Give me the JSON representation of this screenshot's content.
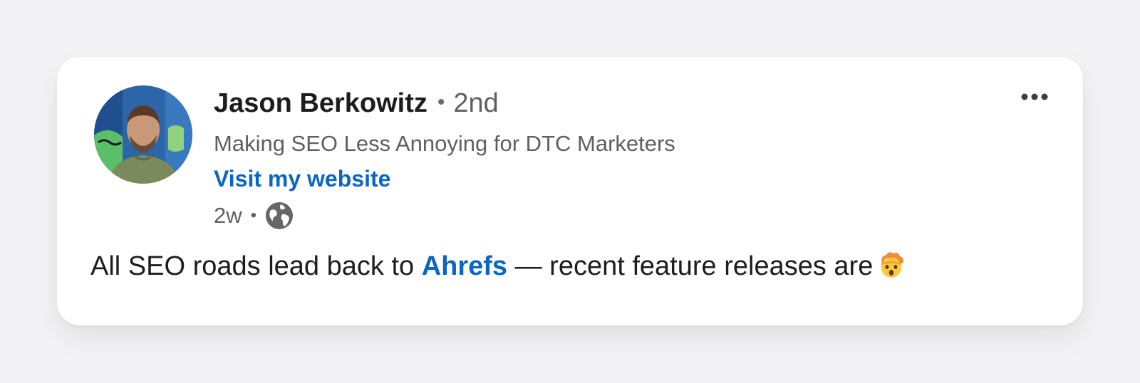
{
  "post": {
    "author": {
      "name": "Jason Berkowitz",
      "separator": "•",
      "connection_degree": "2nd",
      "headline": "Making SEO Less Annoying for DTC Marketers",
      "website_link": "Visit my website"
    },
    "timestamp": "2w",
    "timestamp_separator": "•",
    "visibility_icon": "globe-icon",
    "more_icon": "more-horizontal-icon",
    "text": {
      "before_mention": "All SEO roads lead back to ",
      "mention": "Ahrefs",
      "after_mention": " — recent feature releases are",
      "emoji": "exploding-head-emoji"
    }
  },
  "colors": {
    "background": "#f3f3f5",
    "card": "#ffffff",
    "link": "#0a66c2",
    "primary_text": "#1d1d1d",
    "secondary_text": "#5f5f5f"
  }
}
